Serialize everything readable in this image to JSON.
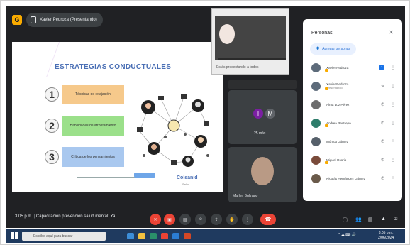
{
  "meet": {
    "presenter_chip": "Xavier Pedroza (Presentando)",
    "meeting_time": "3:05 p.m.",
    "meeting_title": "Capacitación prevención salud mental: Ya..."
  },
  "slide": {
    "title": "ESTRATEGIAS CONDUCTUALES",
    "steps": [
      {
        "num": "1",
        "label": "Técnicas de relajación",
        "color": "#f6c98b"
      },
      {
        "num": "2",
        "label": "Habilidades de afrontamiento",
        "color": "#9be08a"
      },
      {
        "num": "3",
        "label": "Crítica de los pensamientos",
        "color": "#a9c8ef"
      }
    ],
    "logo": "Colsanid",
    "logo_sub": "Salud"
  },
  "mini_window_text": "Estás presentando a todos",
  "tiles": [
    {
      "initials": [
        "I",
        "M"
      ],
      "name": "25 más"
    },
    {
      "name": "Marlen Bultrago"
    }
  ],
  "people_panel": {
    "title": "Personas",
    "add_label": "Agregar personas",
    "people": [
      {
        "name": "Xavier Pedroza",
        "sub": "",
        "avatar_color": "#5d6b7a",
        "icons": [
          "blue",
          "⋮"
        ]
      },
      {
        "name": "Xavier Pedroza",
        "sub": "Presentando",
        "avatar_color": "#5d6b7a",
        "icons": [
          "✎",
          "⋮"
        ]
      },
      {
        "name": "Alma Luz Pérez",
        "sub": "",
        "avatar_color": "#6d6d6d",
        "icons": [
          "✆",
          "⋮"
        ]
      },
      {
        "name": "Andrea Restrepo",
        "sub": "",
        "avatar_color": "#2e7d6b",
        "icons": [
          "✆",
          "⋮"
        ]
      },
      {
        "name": "Mónica Gómez",
        "sub": "",
        "avatar_color": "#56606a",
        "icons": [
          "✆",
          "⋮"
        ]
      },
      {
        "name": "Miguel Osorio",
        "sub": "",
        "avatar_color": "#7a4b3a",
        "icons": [
          "✆",
          "⋮"
        ]
      },
      {
        "name": "Nicolás Hernández Gómez",
        "sub": "",
        "avatar_color": "#6a5a4a",
        "icons": [
          "✆",
          "⋮"
        ]
      }
    ]
  },
  "taskbar": {
    "search_placeholder": "Escribe aquí para buscar",
    "clock": "3:05 p.m.",
    "date": "2/06/2024"
  }
}
